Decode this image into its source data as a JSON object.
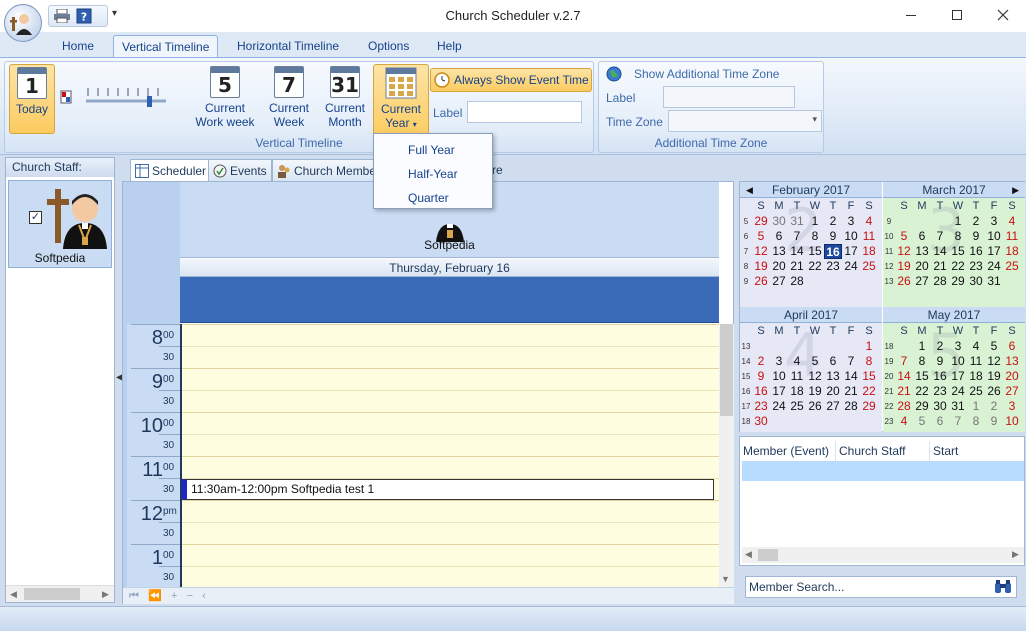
{
  "title": "Church Scheduler v.2.7",
  "tabs": [
    {
      "label": "Home"
    },
    {
      "label": "Vertical Timeline"
    },
    {
      "label": "Horizontal Timeline"
    },
    {
      "label": "Options"
    },
    {
      "label": "Help"
    }
  ],
  "ribbon": {
    "today": {
      "num": "1",
      "label": "Today"
    },
    "work_week": {
      "num": "5",
      "label1": "Current",
      "label2": "Work week"
    },
    "week": {
      "num": "7",
      "label1": "Current",
      "label2": "Week"
    },
    "month": {
      "num": "31",
      "label1": "Current",
      "label2": "Month"
    },
    "year": {
      "label1": "Current",
      "label2": "Year"
    },
    "always_show": "Always Show Event Time",
    "label_text": "Label",
    "group_label": "Vertical Timeline",
    "tz_title": "Show Additional Time Zone",
    "tz_label": "Label",
    "tz_zone": "Time Zone",
    "tz_group_label": "Additional Time Zone"
  },
  "dropdown": [
    "Full Year",
    "Half-Year",
    "Quarter"
  ],
  "staff": {
    "header": "Church Staff:",
    "name": "Softpedia"
  },
  "view_tabs": [
    "Scheduler",
    "Events",
    "Church Members",
    "tore"
  ],
  "scheduler": {
    "resource": "Softpedia",
    "day": "Thursday, February 16",
    "hours": [
      {
        "h": "8",
        "m": "00"
      },
      {
        "h": "9",
        "m": "00"
      },
      {
        "h": "10",
        "m": "00"
      },
      {
        "h": "11",
        "m": "00"
      },
      {
        "h": "12",
        "m": "pm"
      },
      {
        "h": "1",
        "m": "00"
      }
    ],
    "half": "30",
    "event": "11:30am-12:00pm Softpedia test 1"
  },
  "calendars": [
    {
      "name": "February 2017",
      "bg": "2",
      "bgcolor": "#e6e8f6",
      "weeks": [
        {
          "w": "5",
          "d": [
            "29",
            "30",
            "31",
            "1",
            "2",
            "3",
            "4"
          ]
        },
        {
          "w": "6",
          "d": [
            "5",
            "6",
            "7",
            "8",
            "9",
            "10",
            "11"
          ]
        },
        {
          "w": "7",
          "d": [
            "12",
            "13",
            "14",
            "15",
            "16",
            "17",
            "18"
          ]
        },
        {
          "w": "8",
          "d": [
            "19",
            "20",
            "21",
            "22",
            "23",
            "24",
            "25"
          ]
        },
        {
          "w": "9",
          "d": [
            "26",
            "27",
            "28",
            "",
            "",
            "",
            ""
          ]
        }
      ]
    },
    {
      "name": "March 2017",
      "bg": "3",
      "bgcolor": "#d9f2d4",
      "weeks": [
        {
          "w": "9",
          "d": [
            "",
            "",
            "",
            "1",
            "2",
            "3",
            "4"
          ]
        },
        {
          "w": "10",
          "d": [
            "5",
            "6",
            "7",
            "8",
            "9",
            "10",
            "11"
          ]
        },
        {
          "w": "11",
          "d": [
            "12",
            "13",
            "14",
            "15",
            "16",
            "17",
            "18"
          ]
        },
        {
          "w": "12",
          "d": [
            "19",
            "20",
            "21",
            "22",
            "23",
            "24",
            "25"
          ]
        },
        {
          "w": "13",
          "d": [
            "26",
            "27",
            "28",
            "29",
            "30",
            "31",
            ""
          ]
        }
      ]
    },
    {
      "name": "April 2017",
      "bg": "4",
      "bgcolor": "#e6e8f6",
      "weeks": [
        {
          "w": "13",
          "d": [
            "",
            "",
            "",
            "",
            "",
            "",
            "1"
          ]
        },
        {
          "w": "14",
          "d": [
            "2",
            "3",
            "4",
            "5",
            "6",
            "7",
            "8"
          ]
        },
        {
          "w": "15",
          "d": [
            "9",
            "10",
            "11",
            "12",
            "13",
            "14",
            "15"
          ]
        },
        {
          "w": "16",
          "d": [
            "16",
            "17",
            "18",
            "19",
            "20",
            "21",
            "22"
          ]
        },
        {
          "w": "17",
          "d": [
            "23",
            "24",
            "25",
            "26",
            "27",
            "28",
            "29"
          ]
        },
        {
          "w": "18",
          "d": [
            "30",
            "",
            "",
            "",
            "",
            "",
            ""
          ]
        }
      ]
    },
    {
      "name": "May 2017",
      "bg": "5",
      "bgcolor": "#d9f2d4",
      "weeks": [
        {
          "w": "18",
          "d": [
            "",
            "1",
            "2",
            "3",
            "4",
            "5",
            "6"
          ]
        },
        {
          "w": "19",
          "d": [
            "7",
            "8",
            "9",
            "10",
            "11",
            "12",
            "13"
          ]
        },
        {
          "w": "20",
          "d": [
            "14",
            "15",
            "16",
            "17",
            "18",
            "19",
            "20"
          ]
        },
        {
          "w": "21",
          "d": [
            "21",
            "22",
            "23",
            "24",
            "25",
            "26",
            "27"
          ]
        },
        {
          "w": "22",
          "d": [
            "28",
            "29",
            "30",
            "31",
            "1",
            "2",
            "3"
          ]
        },
        {
          "w": "23",
          "d": [
            "4",
            "5",
            "6",
            "7",
            "8",
            "9",
            "10"
          ]
        }
      ]
    }
  ],
  "dow": [
    "S",
    "M",
    "T",
    "W",
    "T",
    "F",
    "S"
  ],
  "members": {
    "columns": [
      "Member (Event)",
      "Church Staff",
      "Start"
    ],
    "search_placeholder": "Member Search..."
  },
  "icons": {
    "print": "printer-icon",
    "help": "help-icon",
    "clock": "clock-icon",
    "globe": "globe-icon",
    "binoculars": "binoculars-icon"
  }
}
